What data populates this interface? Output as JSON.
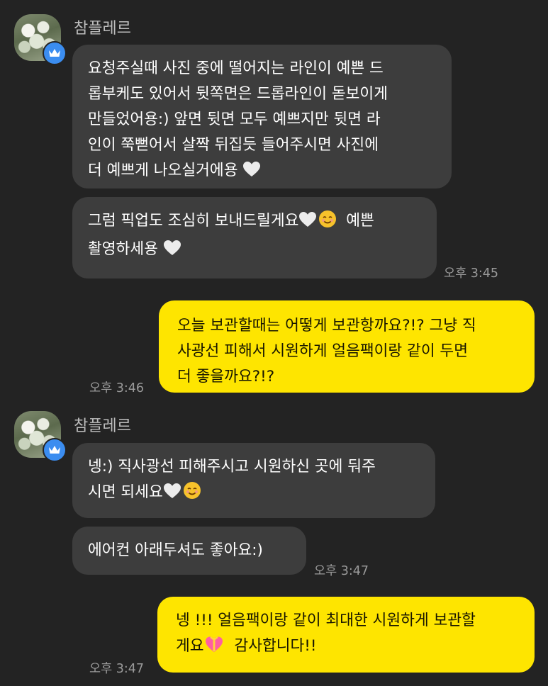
{
  "colors": {
    "background": "#232323",
    "incoming_bubble": "#3d3d3d",
    "outgoing_bubble": "#fee500",
    "badge": "#3b8df0",
    "timestamp": "#9a9a9a"
  },
  "icons": {
    "avatar": "bouquet-photo",
    "badge": "crown-icon",
    "white_heart": "white-heart-emoji",
    "smiling": "smiling-face-emoji",
    "gift_heart": "gift-heart-emoji"
  },
  "messages": [
    {
      "sender": "참플레르",
      "bubbles": [
        {
          "lines": [
            "요청주실때 사진 중에 떨어지는 라인이 예쁜 드",
            "롭부케도 있어서 뒷쪽면은 드롭라인이 돋보이게",
            "만들었어용:) 앞면 뒷면 모두 예쁘지만 뒷면 라",
            "인이 쭉뻗어서 살짝 뒤집듯 들어주시면 사진에",
            "더 예쁘게 나오실거에용"
          ]
        },
        {
          "lines": [
            "그럼 픽업도 조심히 보내드릴게요",
            "예쁜",
            "촬영하세용"
          ],
          "time": "오후 3:45"
        }
      ]
    },
    {
      "outgoing": true,
      "lines": [
        "오늘 보관할때는 어떻게 보관항까요?!? 그냥 직",
        "사광선 피해서 시원하게 얼음팩이랑 같이 두면",
        "더 좋을까요?!?"
      ],
      "time": "오후 3:46"
    },
    {
      "sender": "참플레르",
      "bubbles": [
        {
          "lines": [
            "넹:) 직사광선 피해주시고 시원하신 곳에 둬주",
            "시면 되세요"
          ]
        },
        {
          "lines": [
            "에어컨 아래두셔도 좋아요:)"
          ],
          "time": "오후 3:47"
        }
      ]
    },
    {
      "outgoing": true,
      "lines": [
        "넹 !!! 얼음팩이랑 같이 최대한 시원하게 보관할",
        "게요",
        "감사합니다!!"
      ],
      "time": "오후 3:47"
    }
  ]
}
